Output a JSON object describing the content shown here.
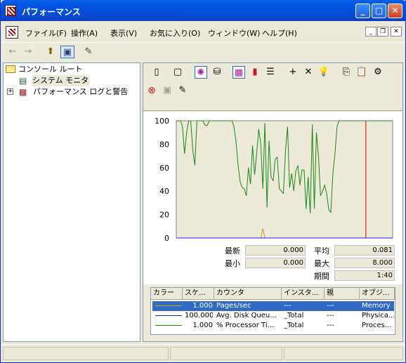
{
  "window": {
    "title": "パフォーマンス"
  },
  "menu": {
    "items": [
      "ファイル(F)",
      "操作(A)",
      "表示(V)",
      "お気に入り(O)",
      "ウィンドウ(W)",
      "ヘルプ(H)"
    ]
  },
  "tree": {
    "root": "コンソール ルート",
    "child1": "システム モニタ",
    "child2": "パフォーマンス ログと警告"
  },
  "y_ticks": [
    "100",
    "80",
    "60",
    "40",
    "20",
    "0"
  ],
  "stats": {
    "latest_label": "最新",
    "latest": "0.000",
    "avg_label": "平均",
    "avg": "0.081",
    "min_label": "最小",
    "min": "0.000",
    "max_label": "最大",
    "max": "8.000",
    "period_label": "期間",
    "period": "1:40"
  },
  "legend": {
    "headers": [
      "カラー",
      "スケ...",
      "カウンタ",
      "インスタ...",
      "親",
      "オブジ..."
    ],
    "rows": [
      {
        "color": "#c8a020",
        "scale": "1.000",
        "counter": "Pages/sec",
        "instance": "---",
        "parent": "---",
        "object": "Memory"
      },
      {
        "color": "#2020d0",
        "scale": "100.000",
        "counter": "Avg. Disk Queu...",
        "instance": "_Total",
        "parent": "---",
        "object": "Physica..."
      },
      {
        "color": "#1a8a1a",
        "scale": "1.000",
        "counter": "% Processor Ti...",
        "instance": "_Total",
        "parent": "---",
        "object": "Proces..."
      }
    ]
  },
  "chart_data": {
    "type": "line",
    "ylim": [
      0,
      100
    ],
    "series": [
      {
        "name": "% Processor Time",
        "color": "#1a8a1a",
        "values": [
          100,
          100,
          100,
          95,
          72,
          90,
          100,
          100,
          75,
          62,
          100,
          100,
          100,
          100,
          96,
          96,
          100,
          100,
          100,
          100,
          100,
          100,
          100,
          100,
          100,
          100,
          100,
          100,
          95,
          82,
          62,
          48,
          43,
          42,
          36,
          60,
          46,
          79,
          54,
          72,
          93,
          80,
          42,
          98,
          26,
          83,
          52,
          49,
          67,
          69,
          42,
          40,
          38,
          75,
          95,
          43,
          55,
          40,
          57,
          62,
          45,
          58,
          58,
          25,
          52,
          21,
          97,
          25,
          90,
          70,
          36,
          40,
          45,
          38,
          24,
          22,
          55,
          72,
          95,
          100,
          100,
          100,
          100,
          100,
          100,
          100,
          100,
          100,
          100,
          100,
          100,
          100,
          100,
          100,
          100,
          100,
          100,
          100,
          100,
          100,
          100,
          100,
          100,
          100,
          100,
          100
        ]
      },
      {
        "name": "Pages/sec",
        "color": "#c8a020",
        "values": [
          0,
          0,
          0,
          0,
          0,
          0,
          0,
          0,
          0,
          0,
          0,
          0,
          0,
          0,
          0,
          0,
          0,
          0,
          0,
          0,
          0,
          0,
          0,
          0,
          0,
          0,
          0,
          0,
          0,
          0,
          0,
          0,
          0,
          0,
          0,
          0,
          0,
          0,
          0,
          0,
          0,
          0,
          8,
          0,
          0,
          0,
          0,
          0,
          0,
          0,
          0,
          0,
          0,
          0,
          0,
          0,
          0,
          0,
          0,
          0,
          0,
          0,
          0,
          0,
          0,
          0,
          0,
          0,
          0,
          0,
          0,
          0,
          0,
          0,
          0,
          0,
          0,
          0,
          0,
          0,
          0,
          0,
          0,
          0,
          0,
          0,
          0,
          0,
          0,
          0,
          0,
          0,
          0,
          0,
          0,
          0,
          0,
          0,
          0,
          0,
          0,
          0,
          0,
          0,
          0,
          0
        ]
      },
      {
        "name": "Avg. Disk Queue Length",
        "color": "#2020d0",
        "values": [
          0,
          0,
          0,
          0,
          0,
          0,
          0,
          0,
          0,
          0,
          0,
          0,
          0,
          0,
          0,
          0,
          0,
          0,
          0,
          0,
          0,
          0,
          0,
          0,
          0,
          0,
          0,
          0,
          0,
          0,
          0,
          0,
          0,
          0,
          0,
          0,
          0,
          0,
          0,
          0,
          0,
          0,
          0,
          0,
          0,
          0,
          0,
          0,
          0,
          0,
          0,
          0,
          0,
          0,
          0,
          0,
          0,
          0,
          0,
          0,
          0,
          0,
          0,
          0,
          0,
          0,
          0,
          0,
          0,
          0,
          0,
          0,
          0,
          0,
          0,
          0,
          0,
          0,
          0,
          0,
          0,
          0,
          0,
          0,
          0,
          0,
          0,
          0,
          0,
          0,
          0,
          0,
          0,
          0,
          0,
          0,
          0,
          0,
          0,
          0,
          0,
          0,
          0,
          0,
          0,
          0
        ]
      }
    ],
    "cursor_index": 92
  }
}
